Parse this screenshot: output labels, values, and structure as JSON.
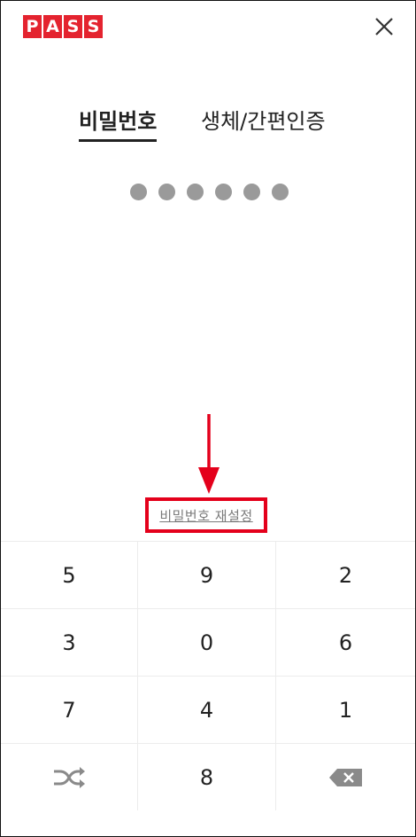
{
  "header": {
    "logo_letters": [
      "P",
      "A",
      "S",
      "S"
    ],
    "brand_color": "#e4232f",
    "close_icon": "close-icon"
  },
  "tabs": [
    {
      "label": "비밀번호",
      "active": true
    },
    {
      "label": "생체/간편인증",
      "active": false
    }
  ],
  "pin": {
    "entered_count": 6,
    "dot_color": "#9a9a9a"
  },
  "reset": {
    "label": "비밀번호 재설정",
    "highlight_color": "#e4001b"
  },
  "keypad": {
    "rows": [
      [
        "5",
        "9",
        "2"
      ],
      [
        "3",
        "0",
        "6"
      ],
      [
        "7",
        "4",
        "1"
      ],
      [
        "",
        "8",
        ""
      ]
    ],
    "shuffle_icon": "shuffle-icon",
    "backspace_icon": "backspace-icon"
  }
}
